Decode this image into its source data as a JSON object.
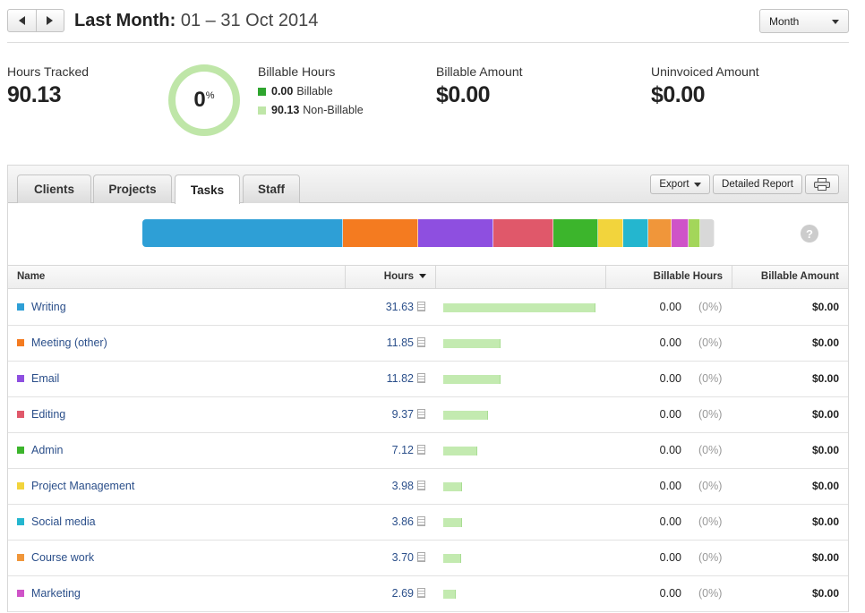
{
  "header": {
    "title_bold": "Last Month:",
    "title_range": "01 – 31 Oct 2014",
    "period_value": "Month"
  },
  "stats": {
    "hours_tracked_label": "Hours Tracked",
    "hours_tracked_value": "90.13",
    "billable_percent": "0",
    "billable_percent_unit": "%",
    "billable_hours_label": "Billable Hours",
    "billable_value": "0.00",
    "billable_text": "Billable",
    "nonbillable_value": "90.13",
    "nonbillable_text": "Non-Billable",
    "billable_amount_label": "Billable Amount",
    "billable_amount_value": "$0.00",
    "uninvoiced_label": "Uninvoiced Amount",
    "uninvoiced_value": "$0.00",
    "colors": {
      "billable": "#2fa52f",
      "nonbillable": "#bfe6a8"
    }
  },
  "tabs": [
    {
      "label": "Clients"
    },
    {
      "label": "Projects"
    },
    {
      "label": "Tasks",
      "active": true
    },
    {
      "label": "Staff"
    }
  ],
  "toolbar": {
    "export_label": "Export",
    "detailed_report_label": "Detailed Report",
    "print_icon": "printer-icon"
  },
  "help_label": "?",
  "table": {
    "headers": {
      "name": "Name",
      "hours": "Hours",
      "billable_hours": "Billable Hours",
      "billable_amount": "Billable Amount"
    },
    "rows": [
      {
        "name": "Writing",
        "color": "#2e9fd6",
        "hours": 31.63,
        "hours_label": "31.63",
        "billable": "0.00",
        "pct": "(0%)",
        "amount": "$0.00"
      },
      {
        "name": "Meeting (other)",
        "color": "#f47b20",
        "hours": 11.85,
        "hours_label": "11.85",
        "billable": "0.00",
        "pct": "(0%)",
        "amount": "$0.00"
      },
      {
        "name": "Email",
        "color": "#8e4fe0",
        "hours": 11.82,
        "hours_label": "11.82",
        "billable": "0.00",
        "pct": "(0%)",
        "amount": "$0.00"
      },
      {
        "name": "Editing",
        "color": "#e0586a",
        "hours": 9.37,
        "hours_label": "9.37",
        "billable": "0.00",
        "pct": "(0%)",
        "amount": "$0.00"
      },
      {
        "name": "Admin",
        "color": "#3cb52c",
        "hours": 7.12,
        "hours_label": "7.12",
        "billable": "0.00",
        "pct": "(0%)",
        "amount": "$0.00"
      },
      {
        "name": "Project Management",
        "color": "#f2d43c",
        "hours": 3.98,
        "hours_label": "3.98",
        "billable": "0.00",
        "pct": "(0%)",
        "amount": "$0.00"
      },
      {
        "name": "Social media",
        "color": "#24b6cf",
        "hours": 3.86,
        "hours_label": "3.86",
        "billable": "0.00",
        "pct": "(0%)",
        "amount": "$0.00"
      },
      {
        "name": "Course work",
        "color": "#f0963a",
        "hours": 3.7,
        "hours_label": "3.70",
        "billable": "0.00",
        "pct": "(0%)",
        "amount": "$0.00"
      },
      {
        "name": "Marketing",
        "color": "#cf53c8",
        "hours": 2.69,
        "hours_label": "2.69",
        "billable": "0.00",
        "pct": "(0%)",
        "amount": "$0.00"
      }
    ]
  },
  "stack_segments": [
    {
      "color": "#2e9fd6",
      "value": 31.63
    },
    {
      "color": "#f47b20",
      "value": 11.85
    },
    {
      "color": "#8e4fe0",
      "value": 11.82
    },
    {
      "color": "#e0586a",
      "value": 9.37
    },
    {
      "color": "#3cb52c",
      "value": 7.12
    },
    {
      "color": "#f2d43c",
      "value": 3.98
    },
    {
      "color": "#24b6cf",
      "value": 3.86
    },
    {
      "color": "#f0963a",
      "value": 3.7
    },
    {
      "color": "#cf53c8",
      "value": 2.69
    },
    {
      "color": "#a3d65a",
      "value": 1.9
    },
    {
      "color": "#d8d8d8",
      "value": 2.2
    }
  ]
}
